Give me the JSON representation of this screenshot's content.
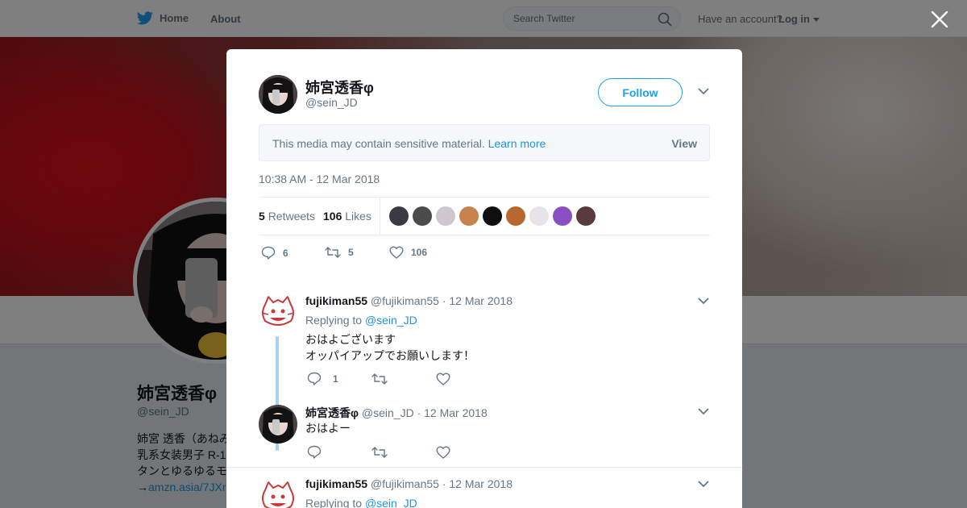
{
  "nav": {
    "home_label": "Home",
    "about_label": "About",
    "search_placeholder": "Search Twitter",
    "have_account": "Have an account?",
    "login_label": "Log in"
  },
  "profile": {
    "name": "姉宮透香φ",
    "handle": "@sein_JD",
    "bio_lines": [
      "姉宮 透香（あねみ",
      "乳系女装男子 R-1",
      "タンとゆるゆるモ"
    ],
    "bio_link_prefix": "→",
    "bio_link": "amzn.asia/7JXr"
  },
  "tweet": {
    "author_name": "姉宮透香φ",
    "author_handle": "@sein_JD",
    "follow_label": "Follow",
    "sensitive_text": "This media may contain sensitive material.",
    "learn_more": "Learn more",
    "view_label": "View",
    "timestamp": "10:38 AM - 12 Mar 2018",
    "retweets_count": "5",
    "retweets_label": "Retweets",
    "likes_count": "106",
    "likes_label": "Likes",
    "reply_count": "6",
    "retweet_count": "5",
    "like_count": "106",
    "liker_colors": [
      "#3a3a44",
      "#4b4b4b",
      "#cfc6cf",
      "#c7814a",
      "#0f0f0f",
      "#b8672e",
      "#e8e3ea",
      "#8a4fc4",
      "#5a3a3a"
    ]
  },
  "replies": [
    {
      "name": "fujikiman55",
      "handle": "@fujikiman55",
      "date": "· 12 Mar 2018",
      "replying_prefix": "Replying to",
      "replying_to": "@sein_JD",
      "lines": [
        "おはよございます",
        "オッパイアップでお願いします！"
      ],
      "reply_count": "1",
      "retweet_count": "",
      "like_count": ""
    },
    {
      "name": "姉宮透香φ",
      "handle": "@sein_JD",
      "date": "· 12 Mar 2018",
      "lines": [
        "おはよー"
      ],
      "reply_count": "",
      "retweet_count": "",
      "like_count": ""
    },
    {
      "name": "fujikiman55",
      "handle": "@fujikiman55",
      "date": "· 12 Mar 2018",
      "replying_prefix": "Replying to",
      "replying_to": "@sein_JD"
    }
  ]
}
